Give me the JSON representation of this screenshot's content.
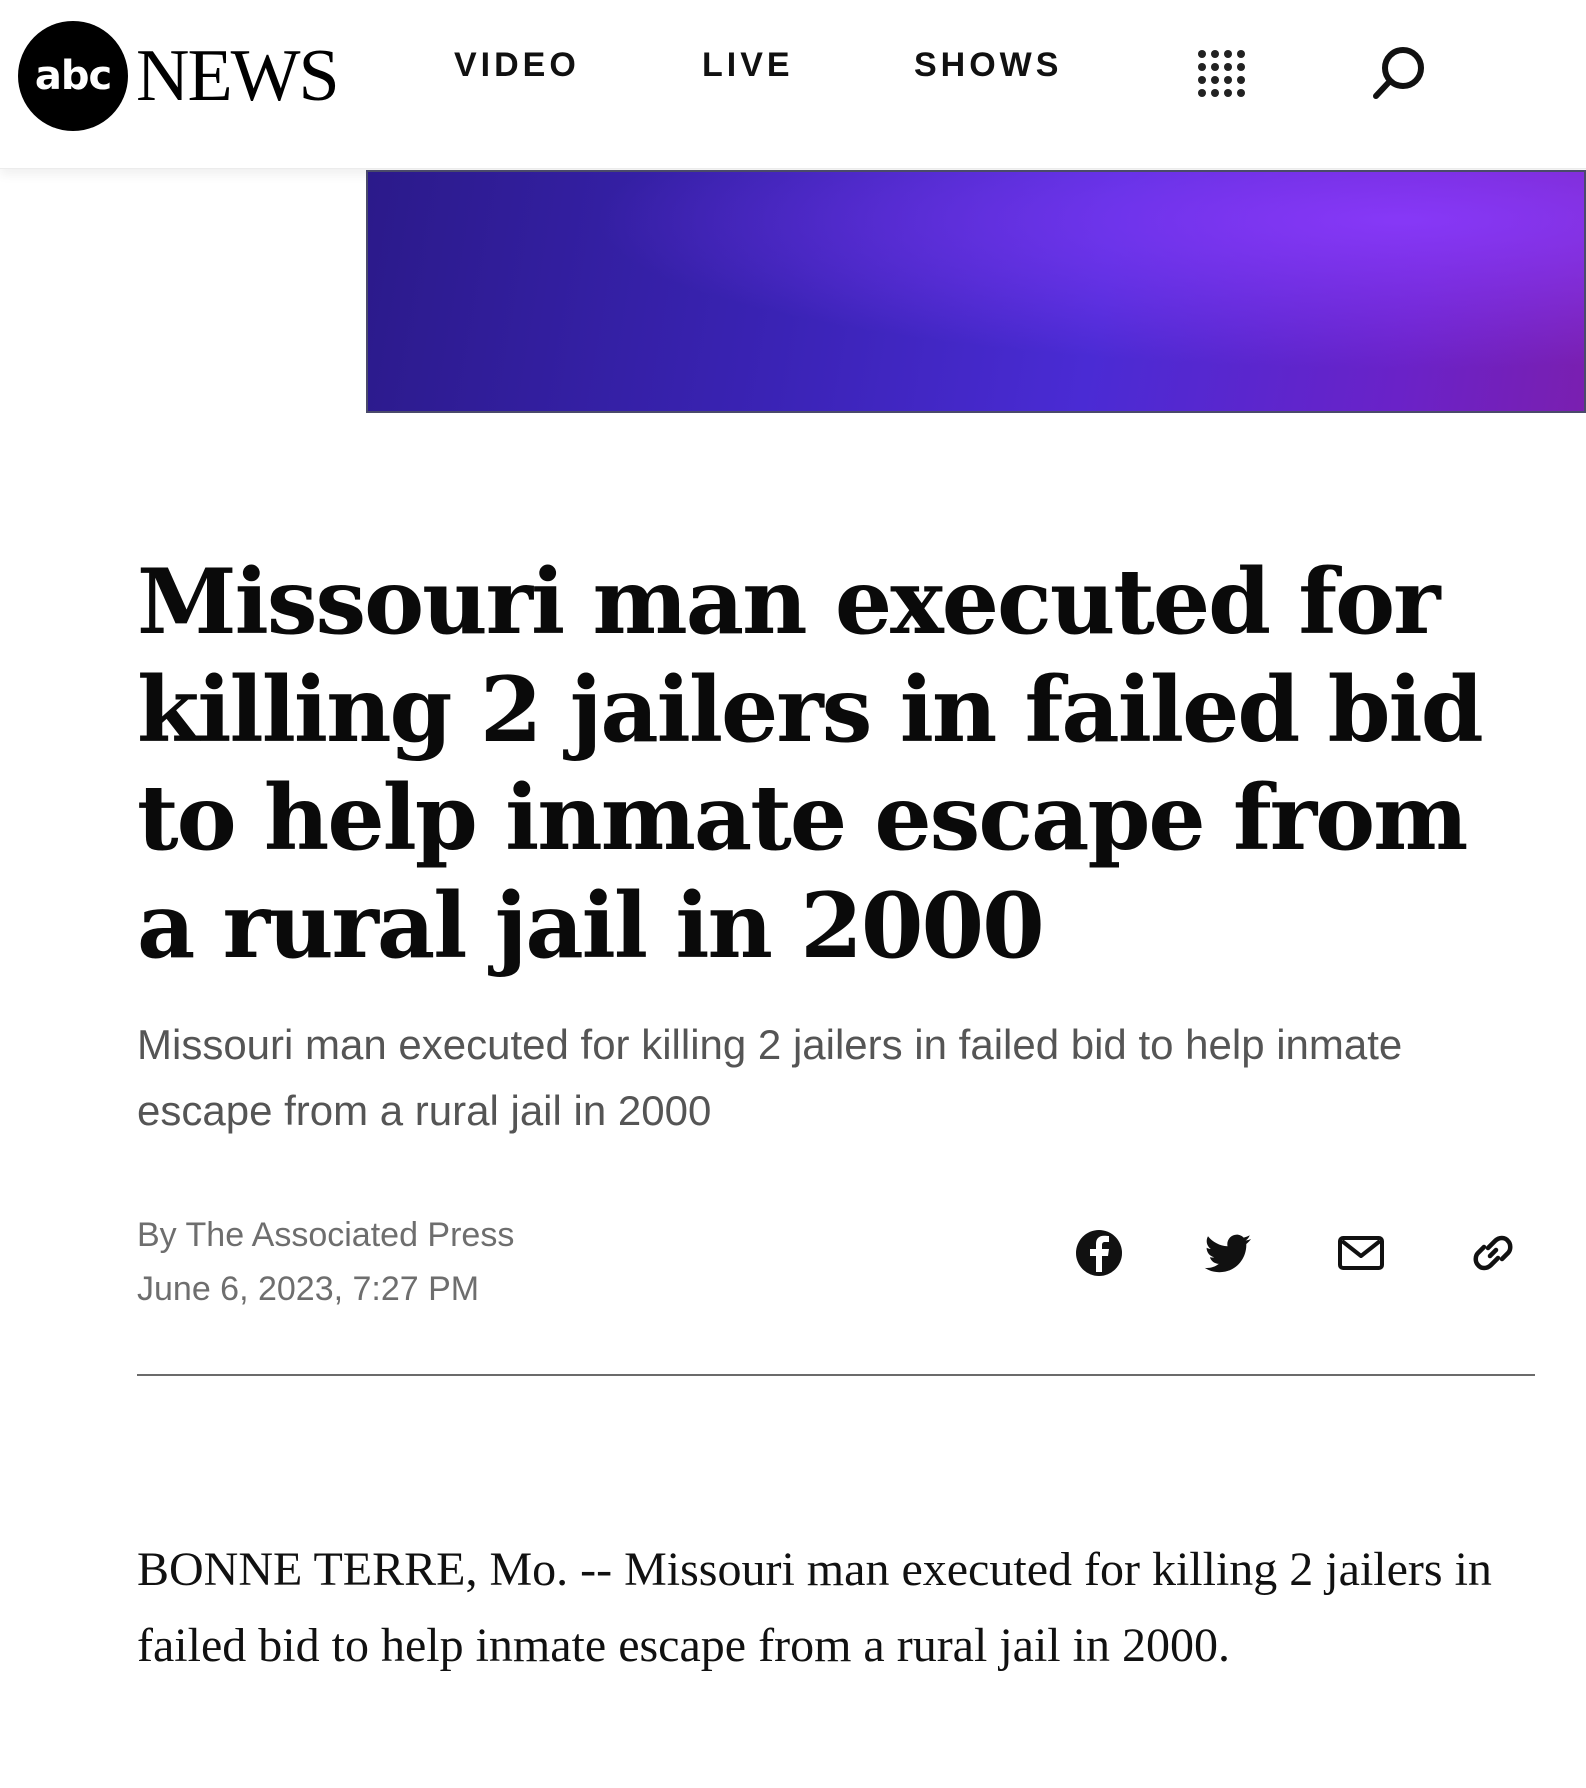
{
  "header": {
    "logo_mark": "abc",
    "logo_word": "NEWS",
    "nav": {
      "video": "VIDEO",
      "live": "LIVE",
      "shows": "SHOWS"
    },
    "icons": {
      "menu": "grid-dots-icon",
      "search": "search-icon"
    }
  },
  "banner": {
    "colors": [
      "#2b1a8a",
      "#4a2bd4",
      "#7a1fb0"
    ]
  },
  "article": {
    "headline": "Missouri man executed for killing 2 jailers in failed bid to help inmate escape from a rural jail in 2000",
    "dek": "Missouri man executed for killing 2 jailers in failed bid to help inmate escape from a rural jail in 2000",
    "byline": "By The Associated Press",
    "date": "June 6, 2023, 7:27 PM",
    "share_icons": [
      "facebook-icon",
      "twitter-icon",
      "email-icon",
      "link-icon"
    ],
    "body": "BONNE TERRE, Mo. -- Missouri man executed for killing 2 jailers in failed bid to help inmate escape from a rural jail in 2000."
  }
}
